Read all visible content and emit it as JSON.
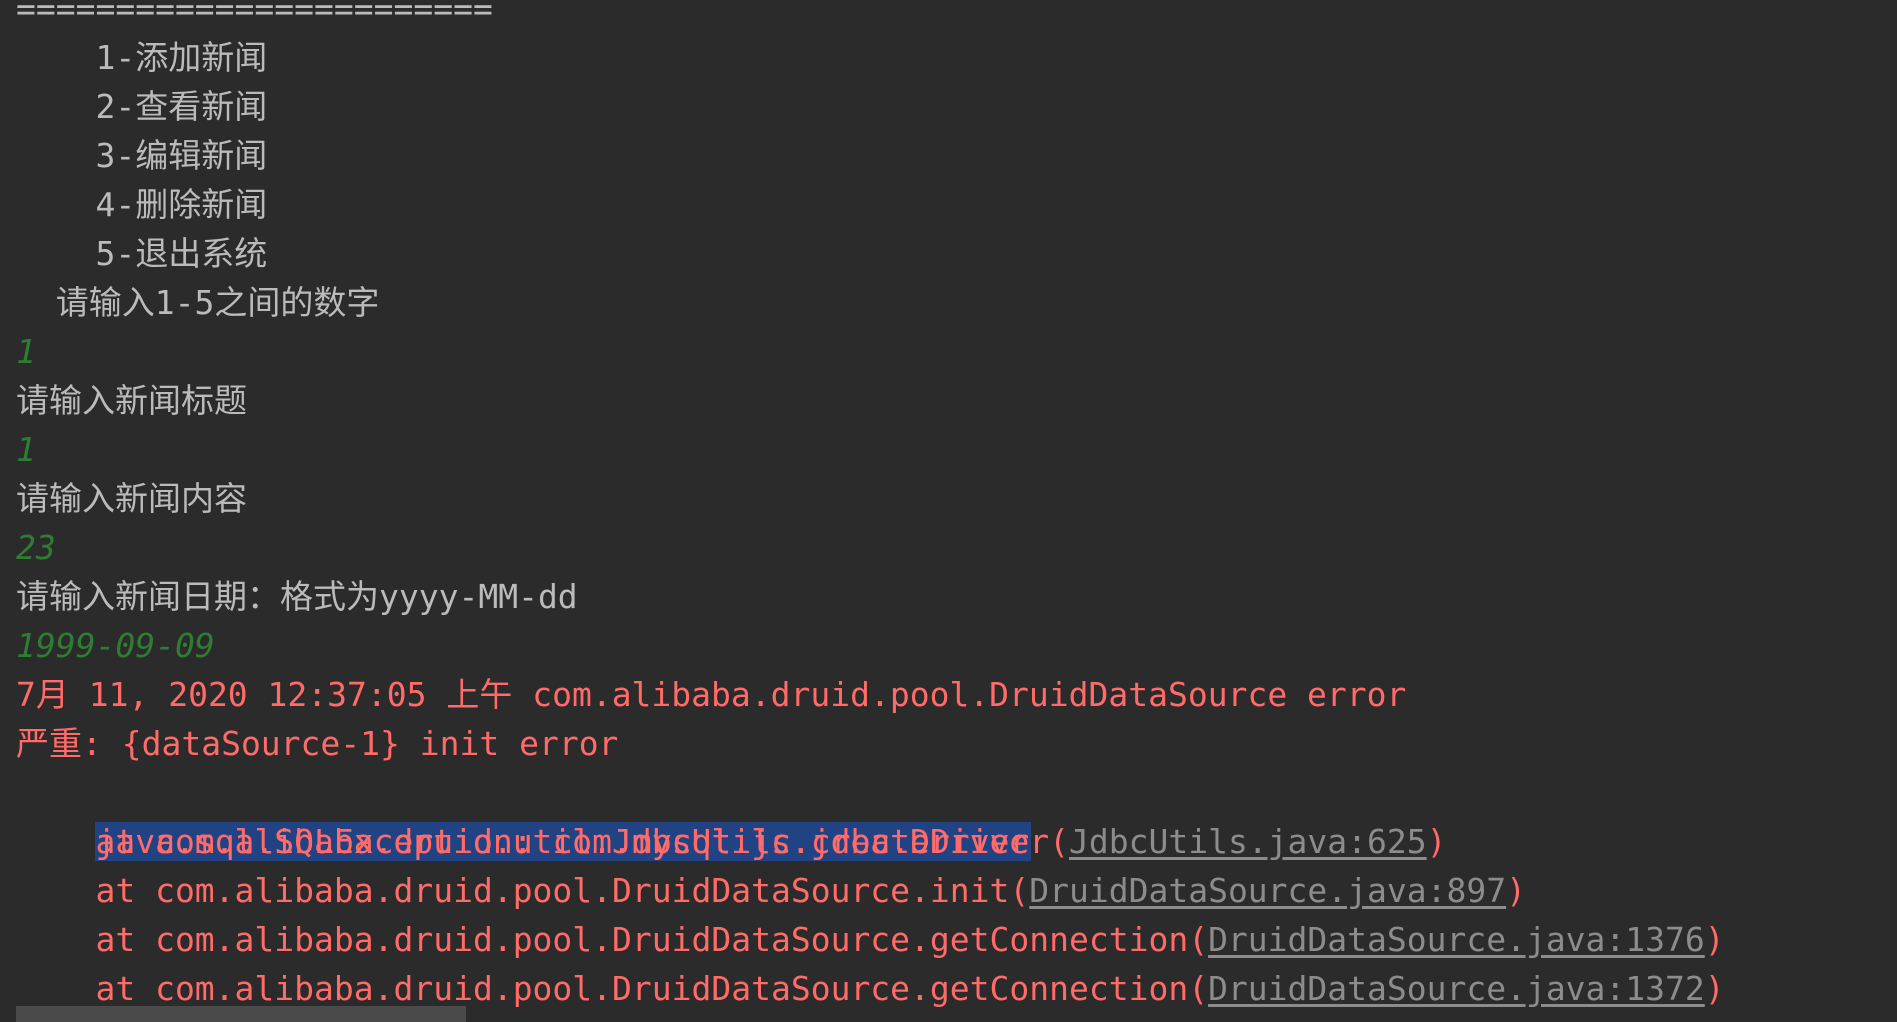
{
  "separator": "========================",
  "menu": [
    "    1-添加新闻",
    "    2-查看新闻",
    "    3-编辑新闻",
    "    4-删除新闻",
    "    5-退出系统"
  ],
  "prompt_choice": "  请输入1-5之间的数字",
  "input_choice": "1",
  "prompt_title": "请输入新闻标题",
  "input_title": "1",
  "prompt_content": "请输入新闻内容",
  "input_content": "23",
  "prompt_date": "请输入新闻日期：格式为yyyy-MM-dd",
  "input_date": "1999-09-09",
  "log_header": "7月 11, 2020 12:37:05 上午 com.alibaba.druid.pool.DruidDataSource error",
  "log_severity": "严重: {dataSource-1} init error",
  "exception": "java.sql.SQLException: com.mysql.jc.jdbc.Driver",
  "stack": [
    {
      "prefix": "    at com.alibaba.druid.util.JdbcUtils.createDriver(",
      "link": "JdbcUtils.java:625",
      "suffix": ")"
    },
    {
      "prefix": "    at com.alibaba.druid.pool.DruidDataSource.init(",
      "link": "DruidDataSource.java:897",
      "suffix": ")"
    },
    {
      "prefix": "    at com.alibaba.druid.pool.DruidDataSource.getConnection(",
      "link": "DruidDataSource.java:1376",
      "suffix": ")"
    },
    {
      "prefix": "    at com.alibaba.druid.pool.DruidDataSource.getConnection(",
      "link": "DruidDataSource.java:1372",
      "suffix": ")"
    }
  ],
  "colors": {
    "background": "#2b2b2b",
    "text": "#bbbbbb",
    "user_input": "#2e7d32",
    "error": "#ff6b68",
    "selection": "#214283",
    "link": "#8c8c8c"
  }
}
